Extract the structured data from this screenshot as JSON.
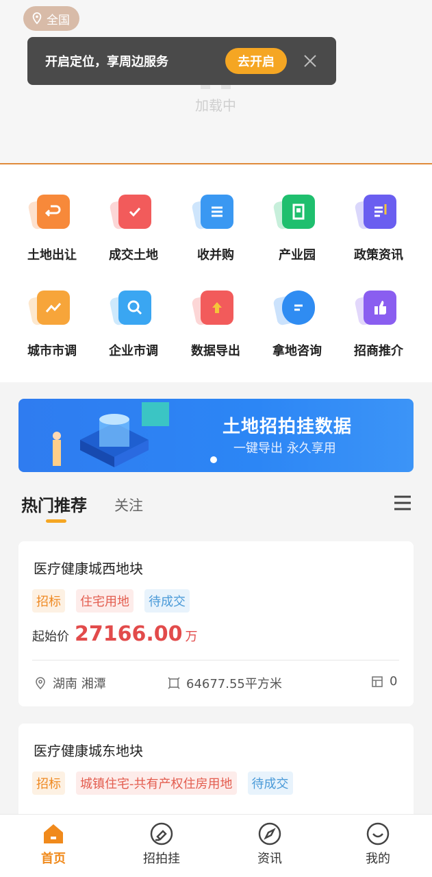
{
  "header": {
    "location": "全国",
    "loading_text": "加载中"
  },
  "toast": {
    "message": "开启定位，享周边服务",
    "button": "去开启"
  },
  "grid": {
    "items": [
      {
        "label": "土地出让",
        "icon": "land-transfer-icon",
        "color": "#f7893a"
      },
      {
        "label": "成交土地",
        "icon": "deal-land-icon",
        "color": "#f25b5b"
      },
      {
        "label": "收并购",
        "icon": "acquisition-icon",
        "color": "#3a98f2"
      },
      {
        "label": "产业园",
        "icon": "industrial-park-icon",
        "color": "#1fbf6e"
      },
      {
        "label": "政策资讯",
        "icon": "policy-news-icon",
        "color": "#6a5ef0"
      },
      {
        "label": "城市市调",
        "icon": "city-survey-icon",
        "color": "#f7a53a"
      },
      {
        "label": "企业市调",
        "icon": "company-survey-icon",
        "color": "#3aa6f2"
      },
      {
        "label": "数据导出",
        "icon": "data-export-icon",
        "color": "#f25b5b"
      },
      {
        "label": "拿地咨询",
        "icon": "land-consult-icon",
        "color": "#2f8cf2"
      },
      {
        "label": "招商推介",
        "icon": "investment-promo-icon",
        "color": "#8a5ef0"
      }
    ]
  },
  "banner": {
    "title": "土地招拍挂数据",
    "subtitle": "一键导出 永久享用"
  },
  "tabs": {
    "hot": "热门推荐",
    "follow": "关注"
  },
  "cards": [
    {
      "title": "医疗健康城西地块",
      "tags": [
        "招标",
        "住宅用地",
        "待成交"
      ],
      "price_label": "起始价",
      "price": "27166.00",
      "unit": "万",
      "location": "湖南  湘潭",
      "area": "64677.55平方米",
      "count": "0"
    },
    {
      "title": "医疗健康城东地块",
      "tags": [
        "招标",
        "城镇住宅-共有产权住房用地",
        "待成交"
      ]
    }
  ],
  "nav": {
    "items": [
      {
        "label": "首页",
        "icon": "home-icon"
      },
      {
        "label": "招拍挂",
        "icon": "auction-icon"
      },
      {
        "label": "资讯",
        "icon": "compass-icon"
      },
      {
        "label": "我的",
        "icon": "profile-icon"
      }
    ]
  },
  "colors": {
    "accent": "#f5a623",
    "price": "#e24b4b",
    "banner": "#2f7cf0"
  }
}
